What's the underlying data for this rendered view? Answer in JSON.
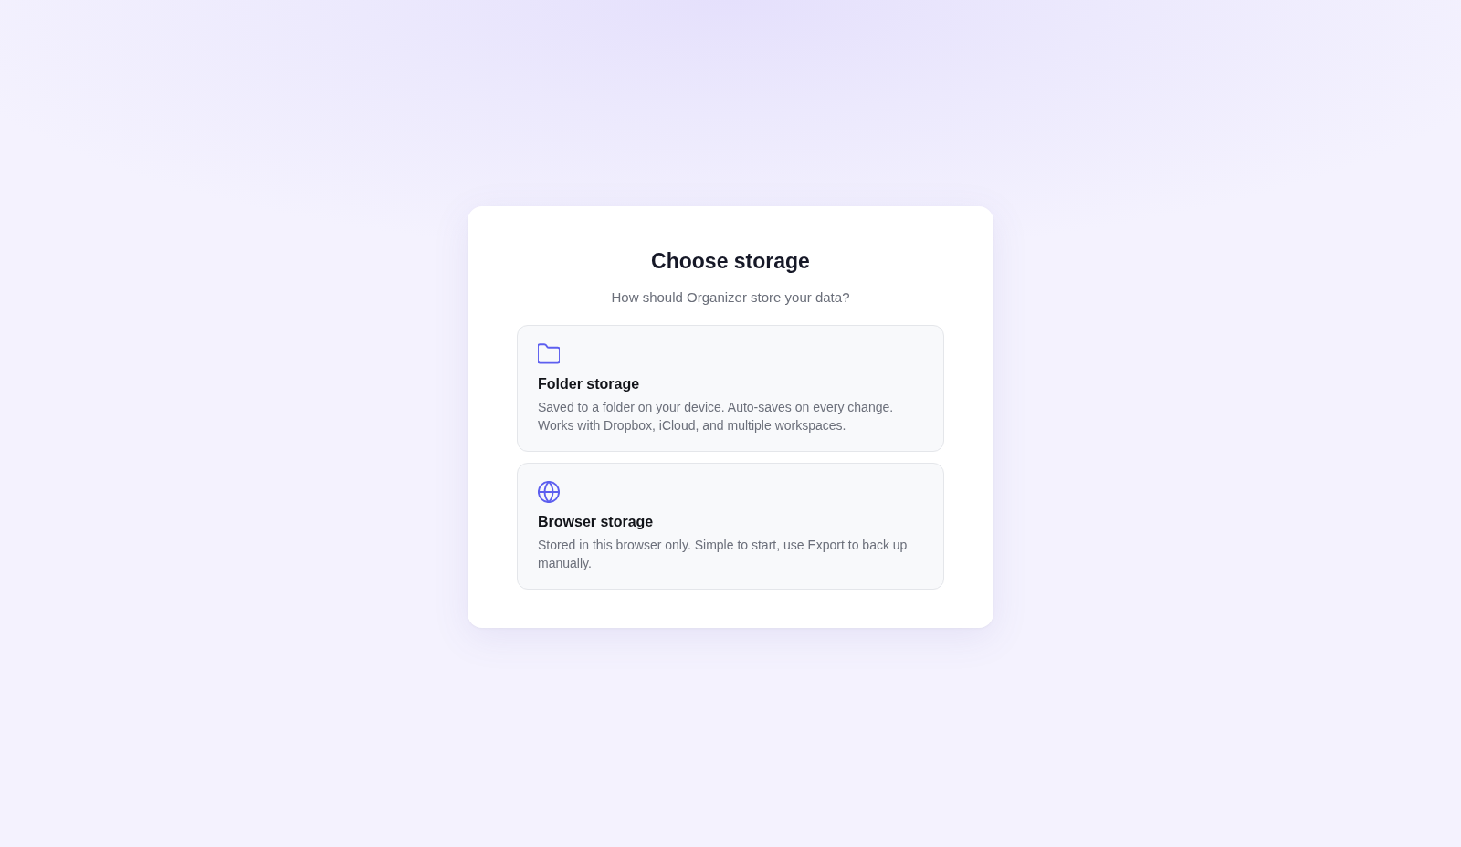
{
  "dialog": {
    "title": "Choose storage",
    "subtitle": "How should Organizer store your data?"
  },
  "options": [
    {
      "kind": "folder",
      "title": "Folder storage",
      "description": "Saved to a folder on your device. Auto-saves on every change. Works with Dropbox, iCloud, and multiple workspaces."
    },
    {
      "kind": "globe",
      "title": "Browser storage",
      "description": "Stored in this browser only. Simple to start, use Export to back up manually."
    }
  ]
}
